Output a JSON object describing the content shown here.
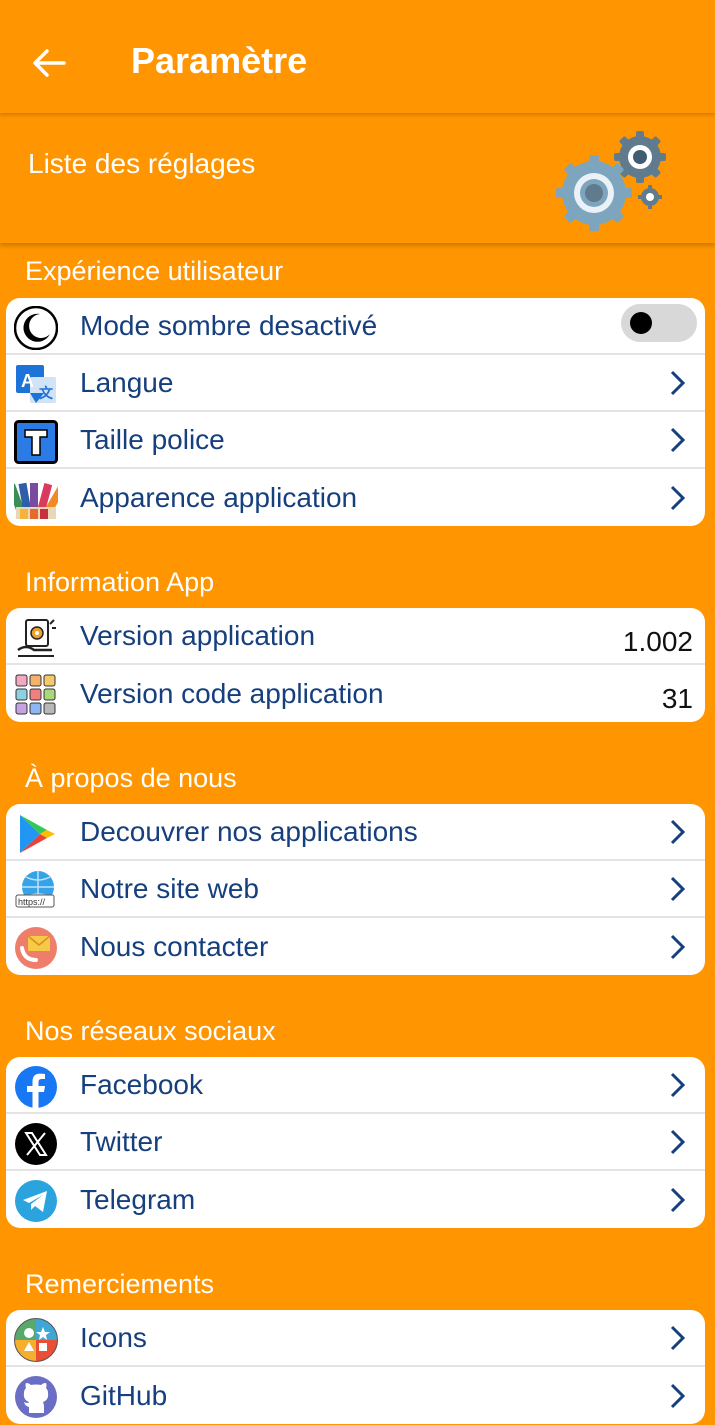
{
  "appbar": {
    "title": "Paramètre"
  },
  "banner": {
    "text": "Liste des réglages"
  },
  "sections": [
    {
      "title": "Expérience utilisateur",
      "items": [
        {
          "label": "Mode sombre desactivé",
          "icon": "moon-icon",
          "toggle": false
        },
        {
          "label": "Langue",
          "icon": "translate-icon"
        },
        {
          "label": "Taille police",
          "icon": "font-size-icon"
        },
        {
          "label": "Apparence application",
          "icon": "palette-icon"
        }
      ]
    },
    {
      "title": "Information App",
      "items": [
        {
          "label": "Version application",
          "icon": "app-version-icon",
          "value": "1.002"
        },
        {
          "label": "Version code application",
          "icon": "grid-code-icon",
          "value": "31"
        }
      ]
    },
    {
      "title": "À propos de nous",
      "items": [
        {
          "label": "Decouvrer nos applications",
          "icon": "play-store-icon"
        },
        {
          "label": "Notre site web",
          "icon": "globe-https-icon"
        },
        {
          "label": "Nous contacter",
          "icon": "contact-mail-icon"
        }
      ]
    },
    {
      "title": "Nos réseaux sociaux",
      "items": [
        {
          "label": "Facebook",
          "icon": "facebook-icon"
        },
        {
          "label": "Twitter",
          "icon": "x-twitter-icon"
        },
        {
          "label": "Telegram",
          "icon": "telegram-icon"
        }
      ]
    },
    {
      "title": "Remerciements",
      "items": [
        {
          "label": "Icons",
          "icon": "icons-credit-icon"
        },
        {
          "label": "GitHub",
          "icon": "github-icon"
        }
      ]
    }
  ],
  "colors": {
    "background": "#FF9500",
    "label": "#163F7E",
    "card": "#FFFFFF",
    "chevron": "#163F7E"
  }
}
